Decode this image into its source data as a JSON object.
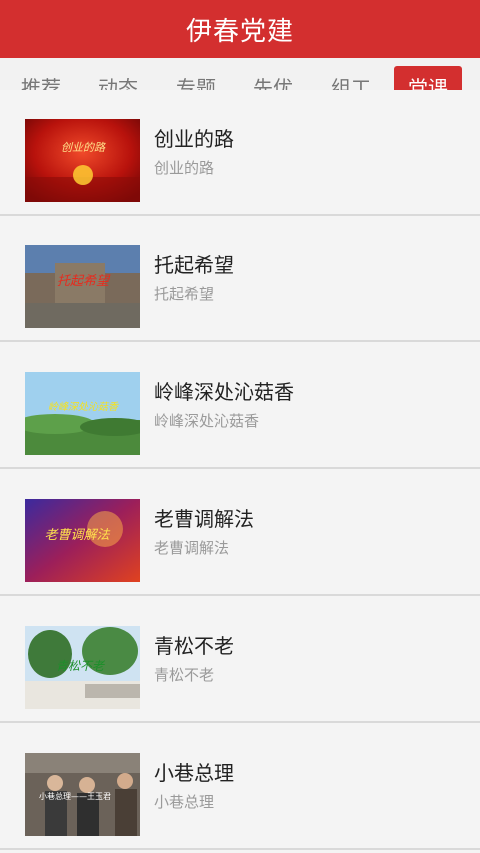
{
  "header": {
    "title": "伊春党建",
    "color": "#d32f2f"
  },
  "tabs": [
    {
      "label": "推荐"
    },
    {
      "label": "动态"
    },
    {
      "label": "专题"
    },
    {
      "label": "先优"
    },
    {
      "label": "组工"
    },
    {
      "label": "党课",
      "active": true
    }
  ],
  "items": [
    {
      "title": "创业的路",
      "subtitle": "创业的路",
      "thumb_text": "创业的路"
    },
    {
      "title": "托起希望",
      "subtitle": "托起希望",
      "thumb_text": "托起希望"
    },
    {
      "title": "岭峰深处沁菇香",
      "subtitle": "岭峰深处沁菇香",
      "thumb_text": "岭峰深处沁菇香"
    },
    {
      "title": "老曹调解法",
      "subtitle": "老曹调解法",
      "thumb_text": "老曹调解法"
    },
    {
      "title": "青松不老",
      "subtitle": "青松不老",
      "thumb_text": "青松不老"
    },
    {
      "title": "小巷总理",
      "subtitle": "小巷总理",
      "thumb_text": "小巷总理——王玉君"
    }
  ]
}
